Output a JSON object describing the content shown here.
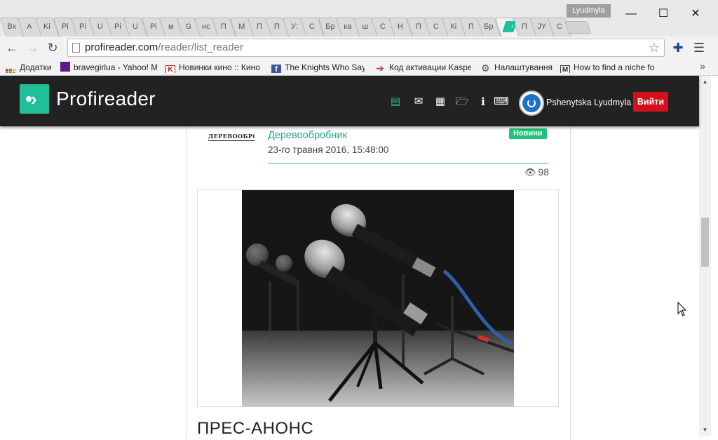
{
  "browser": {
    "tabs": [
      {
        "label": "Вх"
      },
      {
        "label": "A"
      },
      {
        "label": "Ki"
      },
      {
        "label": "Pi"
      },
      {
        "label": "Pi"
      },
      {
        "label": "U"
      },
      {
        "label": "Pi"
      },
      {
        "label": "U"
      },
      {
        "label": "Pi"
      },
      {
        "label": "м"
      },
      {
        "label": "G"
      },
      {
        "label": "нс"
      },
      {
        "label": "П"
      },
      {
        "label": "M"
      },
      {
        "label": "П"
      },
      {
        "label": "П"
      },
      {
        "label": "У:"
      },
      {
        "label": "С"
      },
      {
        "label": "Бр"
      },
      {
        "label": "ка"
      },
      {
        "label": "ш"
      },
      {
        "label": "С"
      },
      {
        "label": "Н"
      },
      {
        "label": "П"
      },
      {
        "label": "С"
      },
      {
        "label": "Кі"
      },
      {
        "label": "П"
      },
      {
        "label": "Бр"
      }
    ],
    "active_tab": {
      "label": "",
      "close": "✕"
    },
    "trailing_tabs": [
      {
        "label": "П"
      },
      {
        "label": "JY"
      },
      {
        "label": "С"
      }
    ],
    "profile_name": "Lyudmyla",
    "window": {
      "minimize": "—",
      "maximize": "☐",
      "close": "✕"
    },
    "url_host": "profireader.com",
    "url_path": "/reader/list_reader",
    "bookmarks": [
      {
        "label": "Додатки",
        "icon": "apps-grid-icon"
      },
      {
        "label": "bravegirlua - Yahoo! M",
        "icon": "yahoo-mail-icon"
      },
      {
        "label": "Новинки кино :: Кино",
        "icon": "kinopoisk-icon"
      },
      {
        "label": "The Knights Who Say",
        "icon": "facebook-icon"
      },
      {
        "label": "Код активации Kaspe",
        "icon": "red-arrow-icon"
      },
      {
        "label": "Налаштування",
        "icon": "gear-icon"
      },
      {
        "label": "How to find a niche fo",
        "icon": "medium-icon"
      }
    ],
    "bookmarks_more": "»"
  },
  "app": {
    "logo_text": "Profireader",
    "user_name": "Pshenytska Lyudmyla",
    "logout_label": "Вийти",
    "nav_icons": [
      "news-feed-icon",
      "mail-icon",
      "building-icon",
      "folder-icon",
      "info-icon",
      "translate-icon"
    ]
  },
  "article": {
    "publisher_logo_text": "ДЕРЕВООБРОБНИК",
    "publisher_name": "Деревообробник",
    "date": "23-го травня 2016, 15:48:00",
    "badge": "Новини",
    "views": "98",
    "headline": "ПРЕС-АНОНС"
  },
  "colors": {
    "brand_teal": "#1fbf9a",
    "header_bg": "#222222",
    "logout_red": "#d0121a",
    "badge_green": "#1fc17b"
  }
}
